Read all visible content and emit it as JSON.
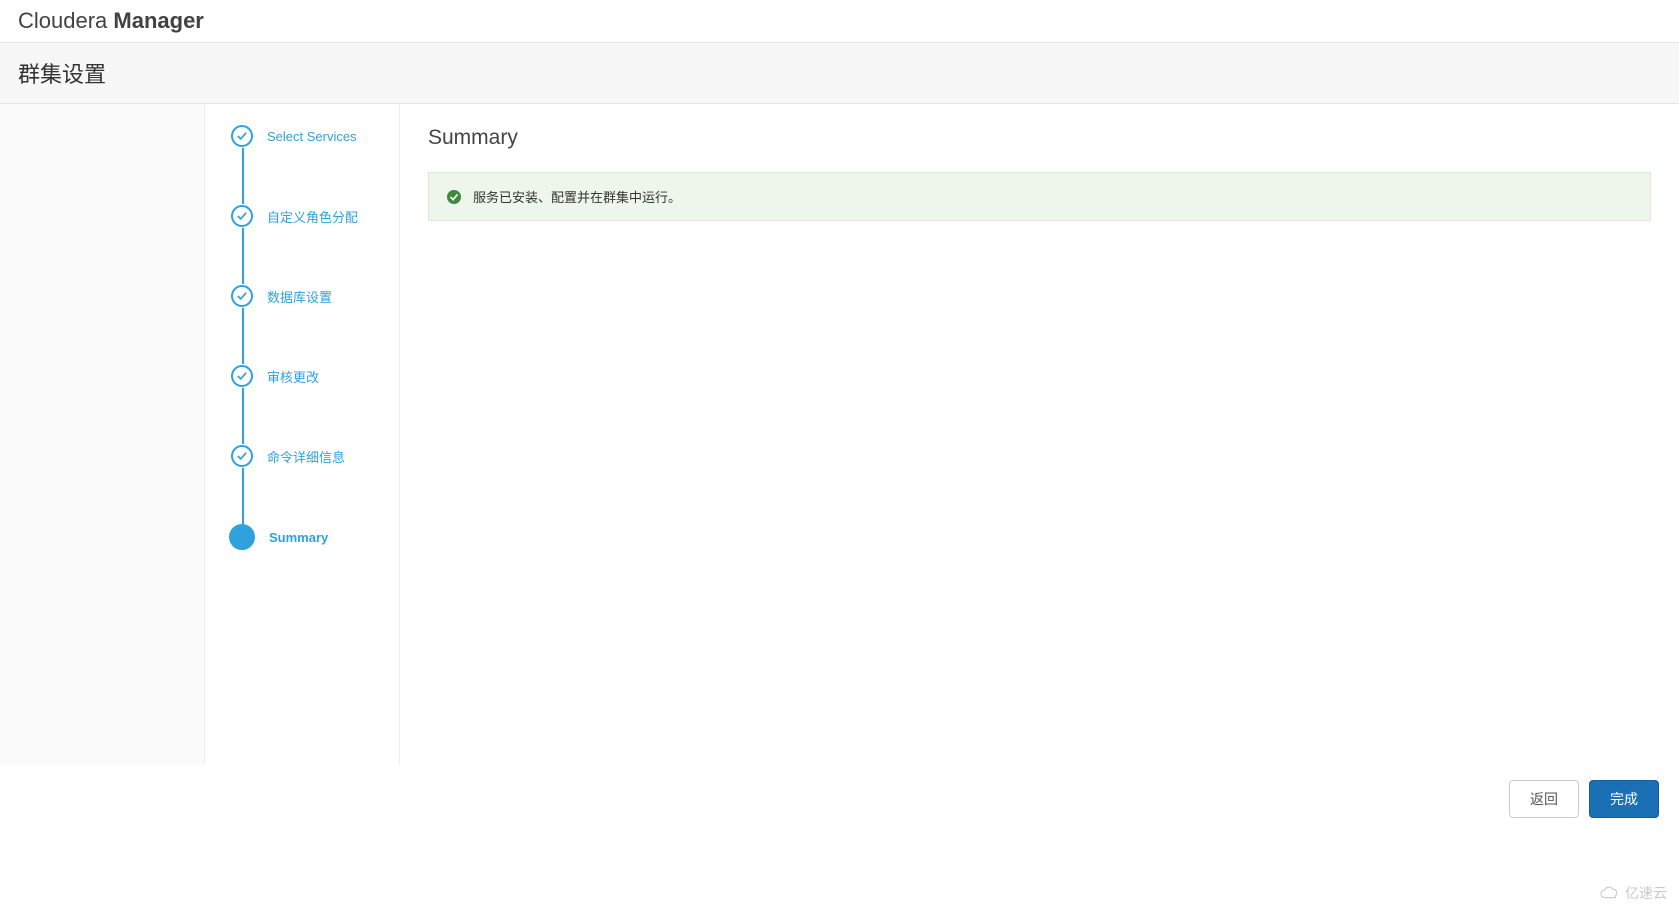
{
  "brand": {
    "light": "Cloudera ",
    "bold": "Manager"
  },
  "subheader": {
    "title": "群集设置"
  },
  "wizard": {
    "steps": [
      {
        "label": "Select Services",
        "state": "done"
      },
      {
        "label": "自定义角色分配",
        "state": "done"
      },
      {
        "label": "数据库设置",
        "state": "done"
      },
      {
        "label": "审核更改",
        "state": "done"
      },
      {
        "label": "命令详细信息",
        "state": "done"
      },
      {
        "label": "Summary",
        "state": "current"
      }
    ]
  },
  "content": {
    "title": "Summary",
    "alert": {
      "message": "服务已安装、配置并在群集中运行。"
    }
  },
  "footer": {
    "back": "返回",
    "finish": "完成"
  },
  "watermark": {
    "text": "亿速云"
  }
}
